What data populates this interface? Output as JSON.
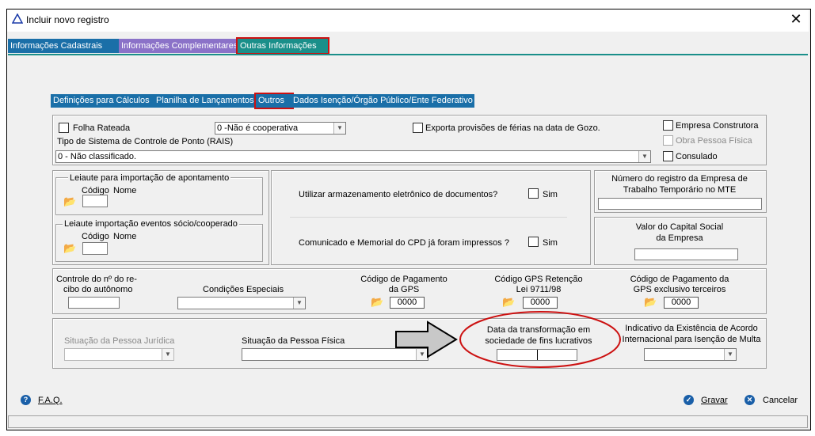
{
  "window": {
    "title": "Incluir novo registro",
    "close_glyph": "✕"
  },
  "main_tabs": [
    {
      "label": "Informações Cadastrais",
      "color": "#1a6fa8"
    },
    {
      "label": "Informações Complementares",
      "color": "#8b72c8"
    },
    {
      "label": "Outras Informações",
      "color": "#1a8f8a"
    }
  ],
  "sub_tabs": [
    {
      "label": "Definições para Cálculos"
    },
    {
      "label": "Planilha de Lançamentos"
    },
    {
      "label": "Outros"
    },
    {
      "label": "Dados Isenção/Órgão Público/Ente Federativo"
    }
  ],
  "top_section": {
    "folha_rateada_label": "Folha Rateada",
    "cooperativa_value": "0 -Não é cooperativa",
    "exporta_label": "Exporta provisões de férias na data de Gozo.",
    "empresa_construtora_label": "Empresa Construtora",
    "obra_pessoa_fisica_label": "Obra Pessoa Física",
    "consulado_label": "Consulado",
    "tipo_sistema_label": "Tipo de Sistema de Controle de Ponto (RAIS)",
    "tipo_sistema_value": "0 - Não classificado."
  },
  "leiaute": {
    "apontamento_title": "Leiaute para importação de apontamento",
    "socio_title": "Leiaute importação eventos sócio/cooperado",
    "codigo_label": "Código",
    "nome_label": "Nome"
  },
  "middle_section": {
    "armazenamento_label": "Utilizar armazenamento eletrônico de documentos?",
    "comunicado_label": "Comunicado e Memorial do CPD já foram impressos ?",
    "sim_label": "Sim"
  },
  "registro_box": {
    "label_line1": "Número do registro da Empresa de",
    "label_line2": "Trabalho Temporário no MTE"
  },
  "capital_box": {
    "label_line1": "Valor do Capital Social",
    "label_line2": "da Empresa"
  },
  "pagamento_section": {
    "controle_line1": "Controle do nº do re-",
    "controle_line2": "cibo do autônomo",
    "condicoes_label": "Condições Especiais",
    "gps_line1": "Código de Pagamento",
    "gps_line2": "da GPS",
    "gps_value": "0000",
    "retencao_line1": "Código GPS Retenção",
    "retencao_line2": "Lei 9711/98",
    "retencao_value": "0000",
    "terceiros_line1": "Código de Pagamento da",
    "terceiros_line2": "GPS exclusivo terceiros",
    "terceiros_value": "0000"
  },
  "situacao_section": {
    "pj_label": "Situação da Pessoa Jurídica",
    "pf_label": "Situação da Pessoa Física",
    "data_line1": "Data da transformação em",
    "data_line2": "sociedade de fins lucrativos",
    "acordo_line1": "Indicativo da Existência de Acordo",
    "acordo_line2": "Internacional para Isenção de Multa"
  },
  "footer": {
    "faq_label": "F.A.Q.",
    "gravar_label": "Gravar",
    "cancelar_label": "Cancelar"
  },
  "colors": {
    "annotation_red": "#cc1111",
    "tab_blue": "#1a6fa8"
  }
}
